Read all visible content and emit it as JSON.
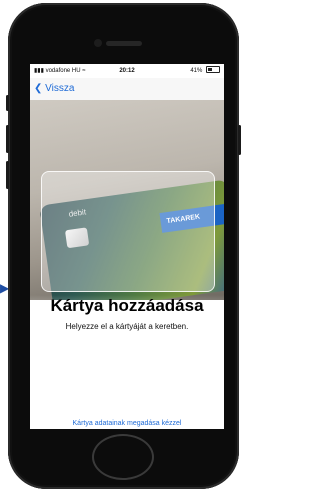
{
  "status_bar": {
    "carrier": "vodafone HU",
    "time": "20:12",
    "battery": "41%"
  },
  "nav": {
    "back_label": "Vissza"
  },
  "camera": {
    "card_label": "debit",
    "card_brand": "TAKAREK"
  },
  "main": {
    "title": "Kártya hozzáadása",
    "subtitle": "Helyezze el a kártyáját a keretben.",
    "manual_entry_link": "Kártya adatainak megadása kézzel"
  },
  "colors": {
    "accent": "#1f6bd6",
    "phone_body": "#0c0c0c"
  }
}
